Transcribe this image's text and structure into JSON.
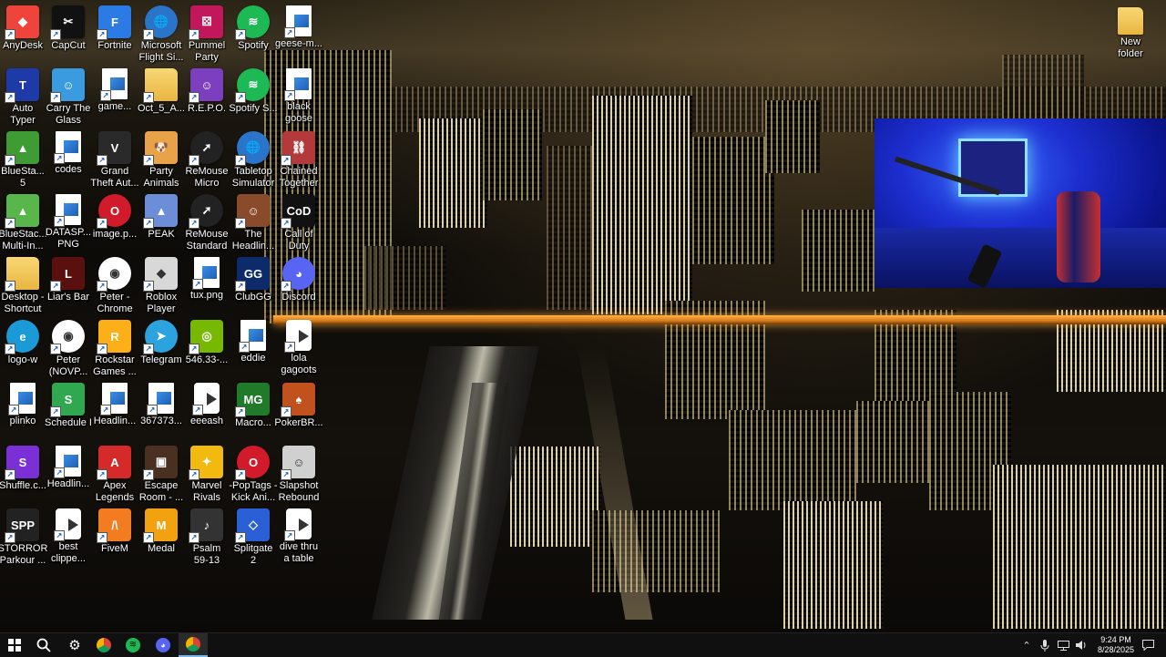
{
  "desktop": {
    "icons": [
      {
        "label": "AnyDesk",
        "icon": "anydesk-icon",
        "color": "#ef443b",
        "glyph": "◆"
      },
      {
        "label": "CapCut",
        "icon": "capcut-icon",
        "color": "#111111",
        "glyph": "✂"
      },
      {
        "label": "Fortnite",
        "icon": "fortnite-icon",
        "color": "#2c7be5",
        "glyph": "F"
      },
      {
        "label": "Microsoft\nFlight Si...",
        "icon": "globe-icon",
        "color": "#2a74c9",
        "glyph": "🌐"
      },
      {
        "label": "Pummel\nParty",
        "icon": "dice-icon",
        "color": "#c2185b",
        "glyph": "⚄"
      },
      {
        "label": "Spotify",
        "icon": "spotify-icon",
        "color": "#1db954",
        "glyph": "≋"
      },
      {
        "label": "geese-m...",
        "icon": "file-icon",
        "color": "#ffffff",
        "glyph": ""
      },
      {
        "label": "Auto\nTyper",
        "icon": "autotyper-icon",
        "color": "#1d3aa8",
        "glyph": "T"
      },
      {
        "label": "Carry The\nGlass",
        "icon": "game-icon",
        "color": "#3a9be0",
        "glyph": "☺"
      },
      {
        "label": "game...",
        "icon": "file-icon",
        "color": "#ffffff",
        "glyph": ""
      },
      {
        "label": "Oct_5_A...",
        "icon": "folder-icon",
        "color": "#f2c94c",
        "glyph": ""
      },
      {
        "label": "R.E.P.O.",
        "icon": "game-icon",
        "color": "#7b3fbf",
        "glyph": "☺"
      },
      {
        "label": "Spotify S...",
        "icon": "spotify-icon",
        "color": "#1db954",
        "glyph": "≋"
      },
      {
        "label": "black\ngoose",
        "icon": "file-icon",
        "color": "#ffffff",
        "glyph": ""
      },
      {
        "label": "BlueSta...\n5",
        "icon": "bluestacks-icon",
        "color": "#3f9c35",
        "glyph": "▲"
      },
      {
        "label": "codes",
        "icon": "file-icon",
        "color": "#ffffff",
        "glyph": ""
      },
      {
        "label": "Grand\nTheft Aut...",
        "icon": "gta-icon",
        "color": "#2a2a2a",
        "glyph": "V"
      },
      {
        "label": "Party\nAnimals",
        "icon": "dog-icon",
        "color": "#e8a349",
        "glyph": "🐶"
      },
      {
        "label": "ReMouse\nMicro",
        "icon": "mouse-icon",
        "color": "#222222",
        "glyph": "➚"
      },
      {
        "label": "Tabletop\nSimulator",
        "icon": "globe-icon",
        "color": "#2a74c9",
        "glyph": "🌐"
      },
      {
        "label": "Chained\nTogether",
        "icon": "game-icon",
        "color": "#b33a3a",
        "glyph": "⛓"
      },
      {
        "label": "BlueStac...\nMulti-In...",
        "icon": "bluestacks-icon",
        "color": "#59b64a",
        "glyph": "▲"
      },
      {
        "label": "DATASP...\nPNG",
        "icon": "file-icon",
        "color": "#ffffff",
        "glyph": ""
      },
      {
        "label": "image.p...",
        "icon": "opera-icon",
        "color": "#d11a2a",
        "glyph": "O"
      },
      {
        "label": "PEAK",
        "icon": "peak-icon",
        "color": "#6c8ed8",
        "glyph": "▲"
      },
      {
        "label": "ReMouse\nStandard",
        "icon": "mouse-icon",
        "color": "#222222",
        "glyph": "➚"
      },
      {
        "label": "The\nHeadlin...",
        "icon": "game-icon",
        "color": "#8a4b2a",
        "glyph": "☺"
      },
      {
        "label": "Call of\nDuty",
        "icon": "cod-icon",
        "color": "#111111",
        "glyph": "CoD"
      },
      {
        "label": "Desktop -\nShortcut",
        "icon": "folder-icon",
        "color": "#f2c94c",
        "glyph": ""
      },
      {
        "label": "Liar's Bar",
        "icon": "game-icon",
        "color": "#5b1010",
        "glyph": "L"
      },
      {
        "label": "Peter -\nChrome",
        "icon": "chrome-icon",
        "color": "#ffffff",
        "glyph": "◉"
      },
      {
        "label": "Roblox\nPlayer",
        "icon": "roblox-icon",
        "color": "#d8d8d8",
        "glyph": "◆"
      },
      {
        "label": "tux.png",
        "icon": "file-icon",
        "color": "#ffffff",
        "glyph": ""
      },
      {
        "label": "ClubGG",
        "icon": "clubgg-icon",
        "color": "#0d2a6b",
        "glyph": "GG"
      },
      {
        "label": "Discord",
        "icon": "discord-icon",
        "color": "#5865f2",
        "glyph": "◕"
      },
      {
        "label": "logo-w",
        "icon": "edge-icon",
        "color": "#1a9ad6",
        "glyph": "e"
      },
      {
        "label": "Peter\n(NOVP...",
        "icon": "chrome-icon",
        "color": "#ffffff",
        "glyph": "◉"
      },
      {
        "label": "Rockstar\nGames ...",
        "icon": "rockstar-icon",
        "color": "#fcaf17",
        "glyph": "R"
      },
      {
        "label": "Telegram",
        "icon": "telegram-icon",
        "color": "#2aa3df",
        "glyph": "➤"
      },
      {
        "label": "546.33-...",
        "icon": "nvidia-icon",
        "color": "#76b900",
        "glyph": "◎"
      },
      {
        "label": "eddie",
        "icon": "file-icon",
        "color": "#ffffff",
        "glyph": ""
      },
      {
        "label": "lola\ngagoots",
        "icon": "video-icon",
        "color": "#ffffff",
        "glyph": ""
      },
      {
        "label": "plinko",
        "icon": "file-icon",
        "color": "#ffffff",
        "glyph": ""
      },
      {
        "label": "Schedule I",
        "icon": "schedule-icon",
        "color": "#2fa84f",
        "glyph": "S"
      },
      {
        "label": "Headlin...",
        "icon": "file-icon",
        "color": "#ffffff",
        "glyph": ""
      },
      {
        "label": "367373...",
        "icon": "file-icon",
        "color": "#ffffff",
        "glyph": ""
      },
      {
        "label": "eeeash",
        "icon": "video-icon",
        "color": "#ffffff",
        "glyph": ""
      },
      {
        "label": "Macro...",
        "icon": "macro-icon",
        "color": "#1f7a2a",
        "glyph": "MG"
      },
      {
        "label": "PokerBR...",
        "icon": "poker-icon",
        "color": "#c2521d",
        "glyph": "♠"
      },
      {
        "label": "Shuffle.c...",
        "icon": "shuffle-icon",
        "color": "#7b2fd6",
        "glyph": "S"
      },
      {
        "label": "Headlin...",
        "icon": "file-icon",
        "color": "#ffffff",
        "glyph": ""
      },
      {
        "label": "Apex\nLegends",
        "icon": "apex-icon",
        "color": "#d52a2a",
        "glyph": "A"
      },
      {
        "label": "Escape\nRoom - ...",
        "icon": "game-icon",
        "color": "#4a3020",
        "glyph": "▣"
      },
      {
        "label": "Marvel\nRivals",
        "icon": "marvel-icon",
        "color": "#f2b90f",
        "glyph": "✦"
      },
      {
        "label": "-PopTags -\nKick Ani...",
        "icon": "opera-icon",
        "color": "#d11a2a",
        "glyph": "O"
      },
      {
        "label": "Slapshot\nRebound",
        "icon": "game-icon",
        "color": "#d0d0d0",
        "glyph": "☺"
      },
      {
        "label": "STORROR\nParkour ...",
        "icon": "game-icon",
        "color": "#222222",
        "glyph": "SPP"
      },
      {
        "label": "best\nclippe...",
        "icon": "video-icon",
        "color": "#ffffff",
        "glyph": ""
      },
      {
        "label": "FiveM",
        "icon": "fivem-icon",
        "color": "#f47c20",
        "glyph": "/\\"
      },
      {
        "label": "Medal",
        "icon": "medal-icon",
        "color": "#f2a20f",
        "glyph": "M"
      },
      {
        "label": "Psalm\n59-13",
        "icon": "game-icon",
        "color": "#333333",
        "glyph": "♪"
      },
      {
        "label": "Splitgate\n2",
        "icon": "splitgate-icon",
        "color": "#2a5fd6",
        "glyph": "◇"
      },
      {
        "label": "dive thru\na table",
        "icon": "video-icon",
        "color": "#ffffff",
        "glyph": ""
      }
    ],
    "right_icon": {
      "label": "New\nfolder",
      "icon": "folder-icon"
    }
  },
  "taskbar": {
    "items": [
      {
        "name": "start-button",
        "icon": "windows-icon"
      },
      {
        "name": "search-button",
        "icon": "search-icon"
      },
      {
        "name": "taskbar-settings",
        "icon": "gear-icon"
      },
      {
        "name": "taskbar-app",
        "icon": "chrome-icon"
      },
      {
        "name": "taskbar-spotify",
        "icon": "spotify-icon"
      },
      {
        "name": "taskbar-discord",
        "icon": "discord-icon"
      },
      {
        "name": "taskbar-chrome",
        "icon": "chrome-icon"
      }
    ],
    "clock": {
      "time": "9:24 PM",
      "date": "8/28/2025"
    }
  }
}
